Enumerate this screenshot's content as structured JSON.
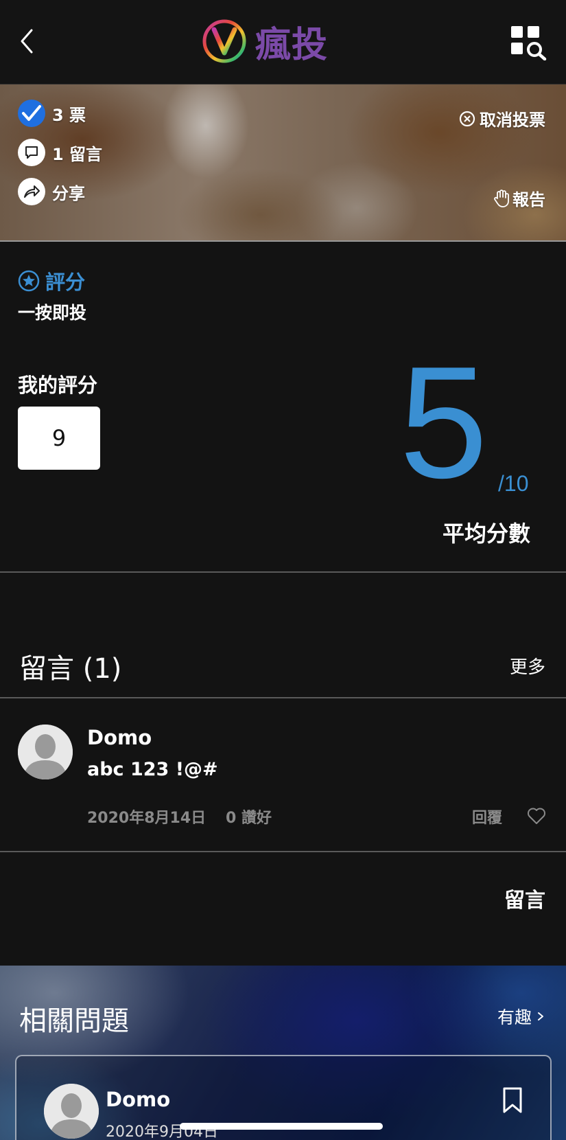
{
  "header": {
    "logo_text": "瘋投"
  },
  "stats": {
    "votes": "3 票",
    "comments": "1 留言",
    "share": "分享",
    "cancel_vote": "取消投票",
    "report": "報告"
  },
  "rating": {
    "title": "評分",
    "subtitle": "一按即投",
    "my_label": "我的評分",
    "my_score": "9",
    "average": "5",
    "denominator": "/10",
    "average_label": "平均分數"
  },
  "comments": {
    "title": "留言 (1)",
    "more": "更多",
    "items": [
      {
        "name": "Domo",
        "text": "abc 123 !@#",
        "date": "2020年8月14日",
        "likes": "0 讚好",
        "reply": "回覆"
      }
    ],
    "post_label": "留言"
  },
  "related": {
    "title": "相關問題",
    "fun": "有趣",
    "card": {
      "name": "Domo",
      "date": "2020年9月04日"
    }
  },
  "colors": {
    "accent_blue": "#3a8fd2",
    "brand_purple": "#7b4aa8",
    "vote_check": "#1f6fe0"
  }
}
